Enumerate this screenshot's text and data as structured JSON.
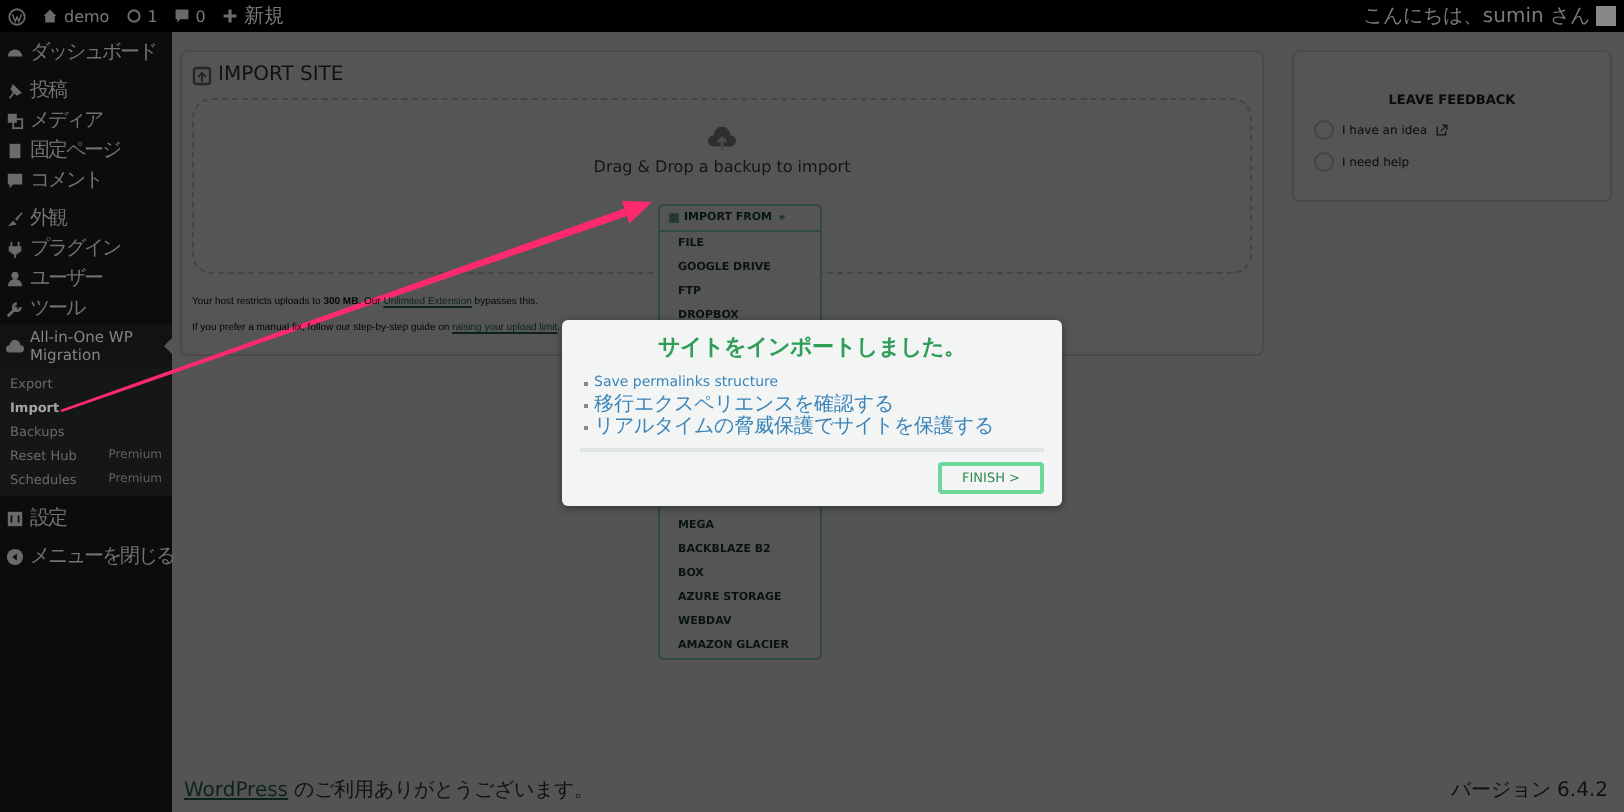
{
  "admin_bar": {
    "site": "demo",
    "updates": "1",
    "comments": "0",
    "new": "新規",
    "greeting": "こんにちは、sumin さん"
  },
  "sidebar": {
    "groups": [
      [
        {
          "label": "ダッシュボード",
          "selected": false
        }
      ],
      [
        {
          "label": "投稿",
          "selected": false
        },
        {
          "label": "メディア",
          "selected": false
        },
        {
          "label": "固定ページ",
          "selected": false
        },
        {
          "label": "コメント",
          "selected": false
        }
      ],
      [
        {
          "label": "外観",
          "selected": false
        },
        {
          "label": "プラグイン",
          "selected": false
        },
        {
          "label": "ユーザー",
          "selected": false
        },
        {
          "label": "ツール",
          "selected": false
        },
        {
          "label": "All-in-One WP Migration",
          "selected": true,
          "children": [
            {
              "label": "Export",
              "selected": false
            },
            {
              "label": "Import",
              "selected": true
            },
            {
              "label": "Backups",
              "selected": false
            },
            {
              "label": "Reset Hub",
              "badge": "Premium",
              "selected": false
            },
            {
              "label": "Schedules",
              "badge": "Premium",
              "selected": false
            }
          ]
        }
      ],
      [
        {
          "label": "設定",
          "selected": false
        }
      ]
    ],
    "collapse": "メニューを閉じる"
  },
  "import": {
    "title": "IMPORT SITE",
    "drop_hint": "Drag & Drop a backup to import",
    "dropdown": {
      "label": "IMPORT FROM",
      "expanded": true,
      "groups": [
        [
          "FILE",
          "GOOGLE DRIVE",
          "FTP",
          "DROPBOX"
        ],
        [
          "MEGA",
          "BACKBLAZE B2",
          "BOX",
          "AZURE STORAGE",
          "WEBDAV",
          "AMAZON GLACIER"
        ]
      ]
    },
    "notes": [
      {
        "before": "Your host restricts uploads to **300 MB**. Our ",
        "link": "Unlimited Extension",
        "after": " bypasses this."
      },
      {
        "before": "If you prefer a manual fix, follow our step-by-step guide on ",
        "link": "raising your upload limit",
        "after": "."
      }
    ]
  },
  "feedback": {
    "title": "LEAVE FEEDBACK",
    "options": [
      {
        "label": "I have an idea",
        "external": true,
        "selected": false
      },
      {
        "label": "I need help",
        "external": false,
        "selected": false
      }
    ]
  },
  "footer": {
    "link": "WordPress",
    "text": " のご利用ありがとうございます。",
    "version": "バージョン 6.4.2"
  },
  "modal": {
    "title": "サイトをインポートしました。",
    "steps": [
      "Save permalinks structure",
      "移行エクスペリエンスを確認する",
      "リアルタイムの脅威保護でサイトを保護する"
    ],
    "button": "FINISH >"
  }
}
